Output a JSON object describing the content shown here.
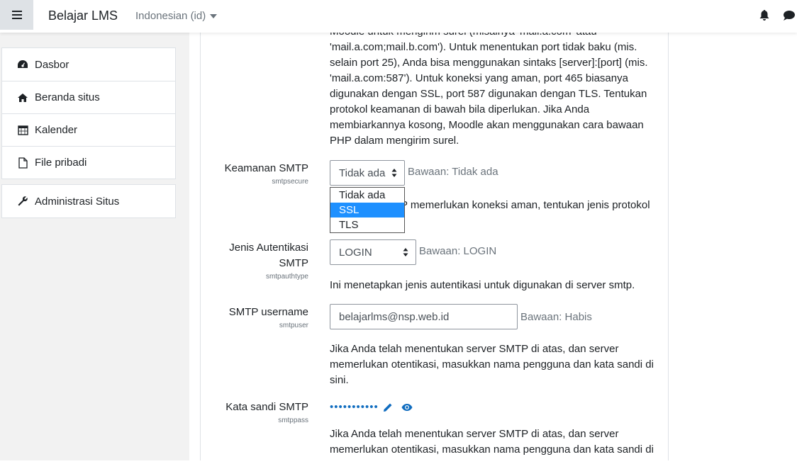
{
  "header": {
    "brand": "Belajar LMS",
    "language": "Indonesian (id)",
    "menu_icon": "hamburger-icon",
    "notification_icon": "bell-icon",
    "messages_icon": "chat-icon"
  },
  "sidebar": {
    "items": [
      {
        "label": "Dasbor",
        "icon": "dashboard-icon"
      },
      {
        "label": "Beranda situs",
        "icon": "home-icon"
      },
      {
        "label": "Kalender",
        "icon": "calendar-icon"
      },
      {
        "label": "File pribadi",
        "icon": "file-icon"
      }
    ],
    "admin": {
      "label": "Administrasi Situs",
      "icon": "wrench-icon"
    }
  },
  "main": {
    "top_desc_lines": [
      "Moodle untuk mengirim surel (misalnya 'mail.a.com' atau",
      "'mail.a.com;mail.b.com'). Untuk menentukan port tidak baku (mis.",
      "selain port 25), Anda bisa menggunakan sintaks [server]:[port] (mis.",
      "'mail.a.com:587'). Untuk koneksi yang aman, port 465 biasanya",
      "digunakan dengan SSL, port 587 digunakan dengan TLS. Tentukan",
      "protokol keamanan di bawah bila diperlukan. Jika Anda",
      "membiarkannya kosong, Moodle akan menggunakan cara bawaan",
      "PHP dalam mengirim surel."
    ],
    "smtpsecure": {
      "label": "Keamanan SMTP",
      "name": "smtpsecure",
      "value": "Tidak ada",
      "default": "Bawaan: Tidak ada",
      "options": [
        "Tidak ada",
        "SSL",
        "TLS"
      ],
      "highlighted": "SSL",
      "desc_visible": "P memerlukan koneksi aman, tentukan jenis protokol"
    },
    "smtpauthtype": {
      "label_line1": "Jenis Autentikasi",
      "label_line2": "SMTP",
      "name": "smtpauthtype",
      "value": "LOGIN",
      "default": "Bawaan: LOGIN",
      "desc": "Ini menetapkan jenis autentikasi untuk digunakan di server smtp."
    },
    "smtpuser": {
      "label": "SMTP username",
      "name": "smtpuser",
      "value": "belajarlms@nsp.web.id",
      "default": "Bawaan: Habis",
      "desc_lines": [
        "Jika Anda telah menentukan server SMTP di atas, dan server",
        "memerlukan otentikasi, masukkan nama pengguna dan kata sandi di",
        "sini."
      ]
    },
    "smtppass": {
      "label": "Kata sandi SMTP",
      "name": "smtppass",
      "masked": "•••••••••••",
      "desc_lines": [
        "Jika Anda telah menentukan server SMTP di atas, dan server",
        "memerlukan otentikasi, masukkan nama pengguna dan kata sandi di"
      ]
    }
  },
  "colors": {
    "accent": "#0f6cbf",
    "highlight": "#1e90ff",
    "sidebar_bg": "#f2f2f2"
  }
}
